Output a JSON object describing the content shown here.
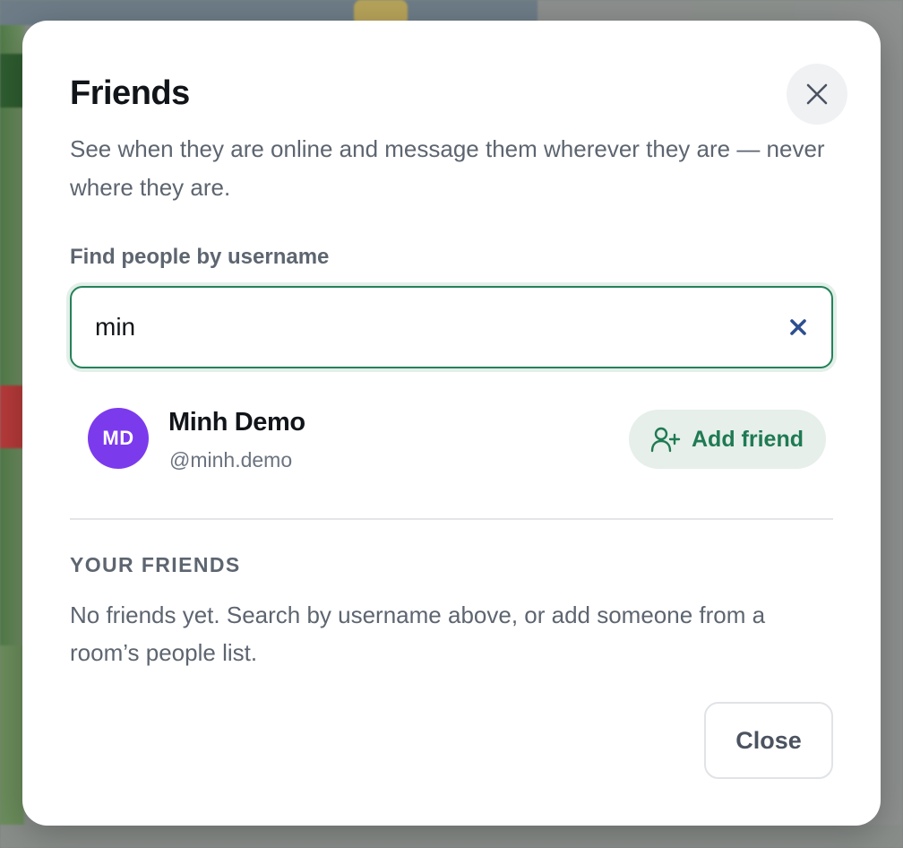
{
  "dialog": {
    "title": "Friends",
    "subtitle": "See when they are online and message them wherever they are — never where they are.",
    "close_icon": "close-icon"
  },
  "search": {
    "label": "Find people by username",
    "value": "min",
    "clear_icon": "clear-icon"
  },
  "result": {
    "initials": "MD",
    "name": "Minh Demo",
    "handle": "@minh.demo",
    "avatar_color": "#7c3aed",
    "add_label": "Add friend",
    "add_icon": "user-plus-icon"
  },
  "friends": {
    "section_title": "YOUR FRIENDS",
    "empty_text": "No friends yet. Search by username above, or add someone from a room’s people list."
  },
  "footer": {
    "close_label": "Close"
  },
  "colors": {
    "accent": "#1f7a53",
    "focus_border": "#24825a"
  }
}
